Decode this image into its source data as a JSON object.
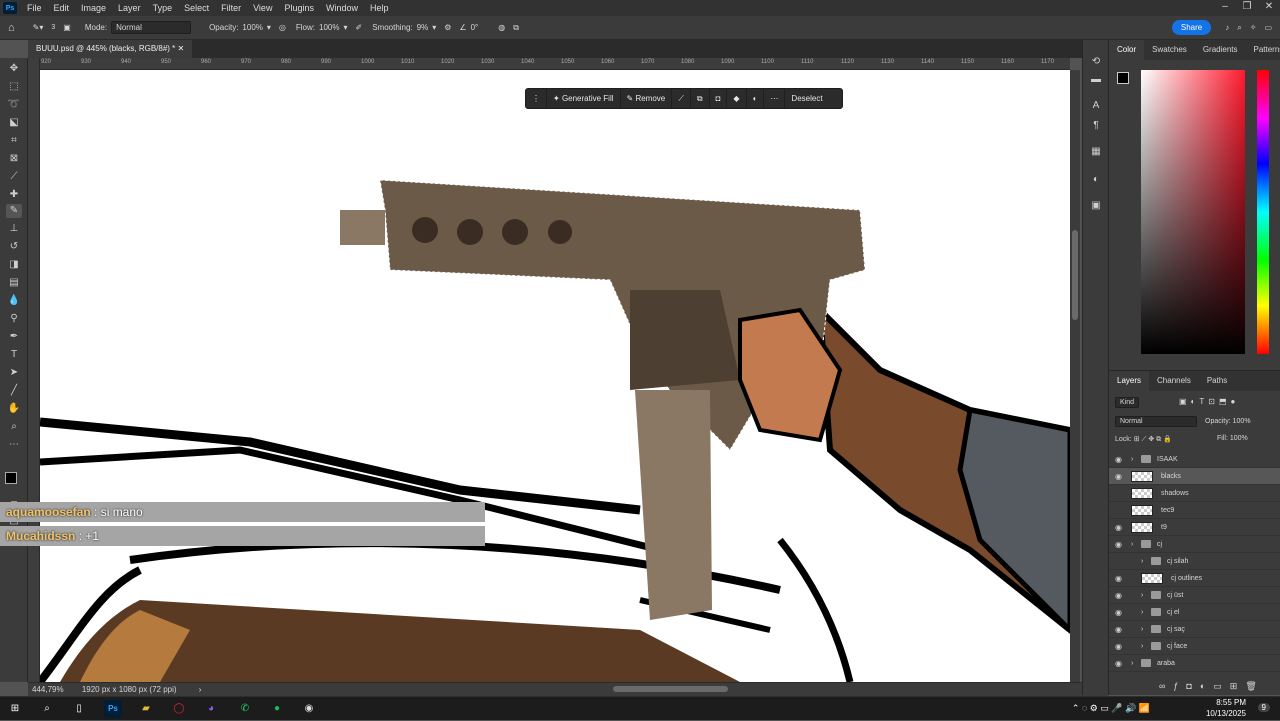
{
  "menu": {
    "items": [
      "File",
      "Edit",
      "Image",
      "Layer",
      "Type",
      "Select",
      "Filter",
      "View",
      "Plugins",
      "Window",
      "Help"
    ]
  },
  "options": {
    "size": "3",
    "mode_label": "Mode:",
    "mode_value": "Normal",
    "opacity_label": "Opacity:",
    "opacity_value": "100%",
    "flow_label": "Flow:",
    "flow_value": "100%",
    "smoothing_label": "Smoothing:",
    "smoothing_value": "9%",
    "angle_value": "0°",
    "share_label": "Share"
  },
  "document": {
    "tab_title": "BUUU.psd @ 445% (blacks, RGB/8#) *"
  },
  "ruler": {
    "ticks": [
      "920",
      "930",
      "940",
      "950",
      "960",
      "970",
      "980",
      "990",
      "1000",
      "1010",
      "1020",
      "1030",
      "1040",
      "1050",
      "1060",
      "1070",
      "1080",
      "1090",
      "1100",
      "1110",
      "1120",
      "1130",
      "1140",
      "1150",
      "1160",
      "1170",
      "1180",
      "1190",
      "1200"
    ]
  },
  "context_bar": {
    "generative_fill": "Generative Fill",
    "remove": "Remove",
    "deselect": "Deselect"
  },
  "chat": [
    {
      "user": "aquamoosefan",
      "text": " : si mano"
    },
    {
      "user": "Mucahidssn",
      "text": " : +1"
    }
  ],
  "status": {
    "zoom": "444,79%",
    "doc_size": "1920 px x 1080 px (72 ppi)"
  },
  "color_panel": {
    "tabs": [
      "Color",
      "Swatches",
      "Gradients",
      "Patterns"
    ],
    "foreground": "#000000",
    "background": "#7a3a1a"
  },
  "layers_panel": {
    "tabs": [
      "Layers",
      "Channels",
      "Paths"
    ],
    "kind_label": "Kind",
    "blend_mode": "Normal",
    "opacity_label": "Opacity:",
    "opacity_value": "100%",
    "lock_label": "Lock:",
    "fill_label": "Fill:",
    "fill_value": "100%",
    "layers": [
      {
        "name": "ISAAK",
        "type": "group",
        "visible": true,
        "indent": 0
      },
      {
        "name": "blacks",
        "type": "layer",
        "visible": true,
        "indent": 0,
        "selected": true
      },
      {
        "name": "shadows",
        "type": "layer",
        "visible": false,
        "indent": 0
      },
      {
        "name": "tec9",
        "type": "layer",
        "visible": false,
        "indent": 0
      },
      {
        "name": "t9",
        "type": "layer",
        "visible": true,
        "indent": 0
      },
      {
        "name": "cj",
        "type": "group",
        "visible": true,
        "indent": 0
      },
      {
        "name": "cj silah",
        "type": "group",
        "visible": false,
        "indent": 1
      },
      {
        "name": "cj outlines",
        "type": "layer",
        "visible": true,
        "indent": 1
      },
      {
        "name": "cj üst",
        "type": "group",
        "visible": true,
        "indent": 1
      },
      {
        "name": "cj el",
        "type": "group",
        "visible": true,
        "indent": 1
      },
      {
        "name": "cj saç",
        "type": "group",
        "visible": true,
        "indent": 1
      },
      {
        "name": "cj face",
        "type": "group",
        "visible": true,
        "indent": 1
      },
      {
        "name": "araba",
        "type": "group",
        "visible": true,
        "indent": 0
      }
    ]
  },
  "taskbar": {
    "time": "8:55 PM",
    "date": "10/13/2025",
    "notification_count": "9"
  }
}
